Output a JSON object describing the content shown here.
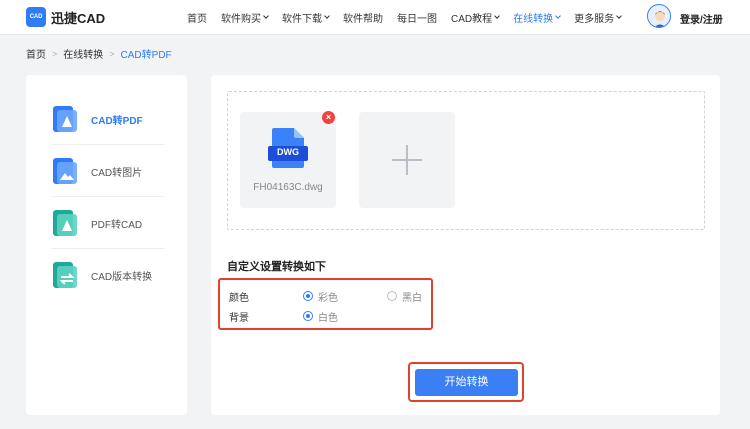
{
  "header": {
    "logo_badge": "CAD",
    "logo_text": "迅捷CAD",
    "nav": [
      {
        "label": "首页",
        "dropdown": false,
        "active": false
      },
      {
        "label": "软件购买",
        "dropdown": true,
        "active": false
      },
      {
        "label": "软件下载",
        "dropdown": true,
        "active": false
      },
      {
        "label": "软件帮助",
        "dropdown": false,
        "active": false
      },
      {
        "label": "每日一图",
        "dropdown": false,
        "active": false
      },
      {
        "label": "CAD教程",
        "dropdown": true,
        "active": false
      },
      {
        "label": "在线转换",
        "dropdown": true,
        "active": true
      },
      {
        "label": "更多服务",
        "dropdown": true,
        "active": false
      }
    ],
    "login_label": "登录/注册"
  },
  "breadcrumb": {
    "items": [
      "首页",
      "在线转换",
      "CAD转PDF"
    ]
  },
  "sidebar": {
    "items": [
      {
        "label": "CAD转PDF",
        "active": true
      },
      {
        "label": "CAD转图片",
        "active": false
      },
      {
        "label": "PDF转CAD",
        "active": false
      },
      {
        "label": "CAD版本转换",
        "active": false
      }
    ]
  },
  "upload": {
    "file_type": "DWG",
    "file_name": "FH04163C.dwg",
    "remove_glyph": "×"
  },
  "settings": {
    "title": "自定义设置转换如下",
    "rows": [
      {
        "label": "颜色",
        "options": [
          {
            "label": "彩色",
            "checked": true
          },
          {
            "label": "黑白",
            "checked": false
          }
        ]
      },
      {
        "label": "背景",
        "options": [
          {
            "label": "白色",
            "checked": true
          }
        ]
      }
    ]
  },
  "actions": {
    "start_label": "开始转换"
  },
  "colors": {
    "accent": "#2f7cf6",
    "highlight": "#e0432c"
  }
}
